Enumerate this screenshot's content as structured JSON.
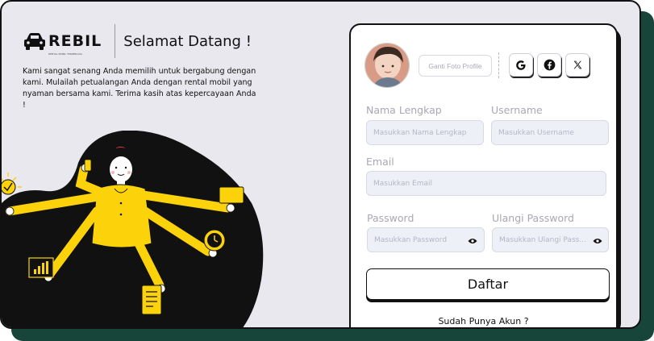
{
  "brand": {
    "logo_text": "REBIL",
    "logo_tagline": "RENTAL MOBIL TERPERCAYA",
    "welcome_title": "Selamat Datang !",
    "welcome_text": "Kami sangat senang Anda memilih untuk bergabung dengan kami. Mulailah petualangan Anda dengan rental mobil yang nyaman bersama kami. Terima kasih atas kepercayaan Anda !"
  },
  "form": {
    "change_photo_label": "Ganti Foto Profile",
    "social": [
      {
        "name": "google",
        "icon": "google-icon"
      },
      {
        "name": "facebook",
        "icon": "facebook-icon"
      },
      {
        "name": "x",
        "icon": "x-icon"
      }
    ],
    "full_name": {
      "label": "Nama Lengkap",
      "placeholder": "Masukkan Nama Lengkap"
    },
    "username": {
      "label": "Username",
      "placeholder": "Masukkan Username"
    },
    "email": {
      "label": "Email",
      "placeholder": "Masukkan Email"
    },
    "password": {
      "label": "Password",
      "placeholder": "Masukkan Password"
    },
    "confirm_password": {
      "label": "Ulangi Password",
      "placeholder": "Masukkan Ulangi Pass..."
    },
    "submit_label": "Daftar",
    "have_account_text": "Sudah Punya Akun ?"
  },
  "colors": {
    "background": "#e8e8ee",
    "accent_yellow": "#fcd20a",
    "shadow_green": "#17453a",
    "input_bg": "#eef0f7"
  }
}
